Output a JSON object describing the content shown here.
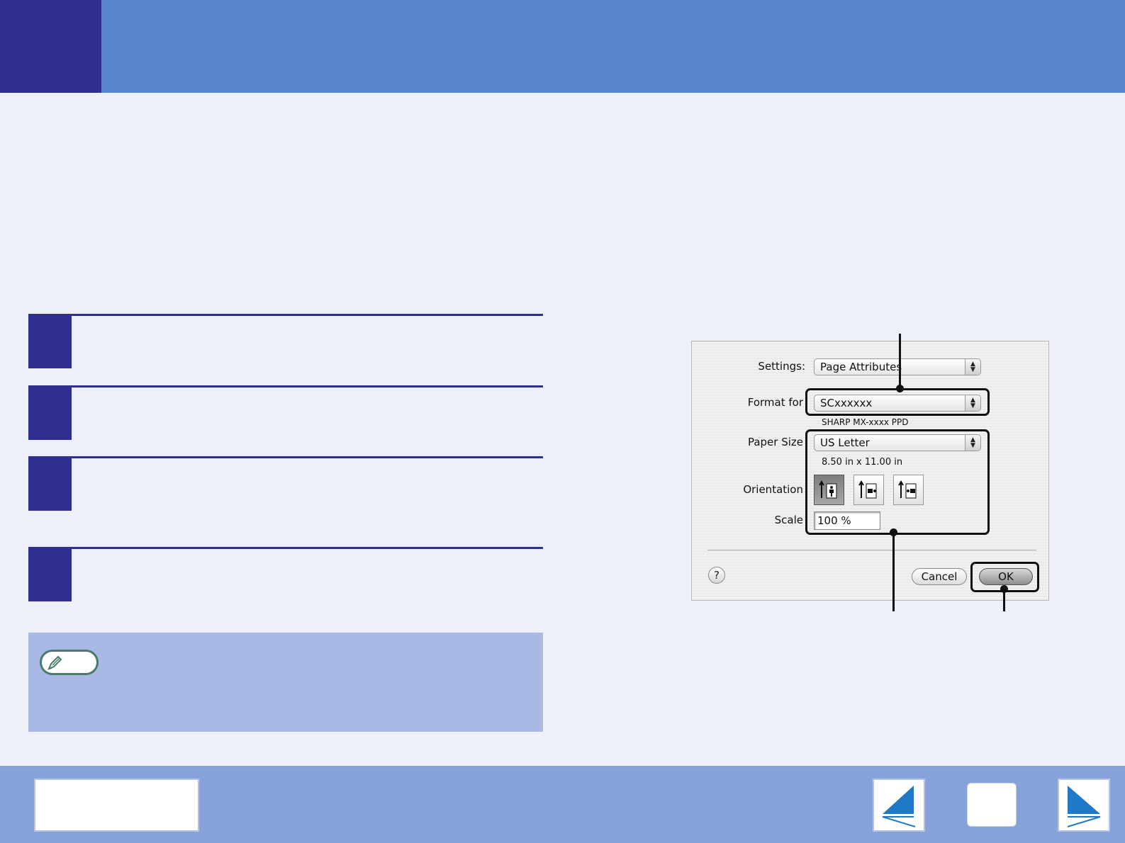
{
  "dialog": {
    "settings_label": "Settings:",
    "settings_value": "Page Attributes",
    "format_label": "Format for",
    "format_value": "SCxxxxxx",
    "format_sub": "SHARP MX-xxxx PPD",
    "paper_label": "Paper Size",
    "paper_value": "US Letter",
    "paper_sub": "8.50 in x 11.00 in",
    "orientation_label": "Orientation",
    "scale_label": "Scale",
    "scale_value": "100 %",
    "help_label": "?",
    "cancel_label": "Cancel",
    "ok_label": "OK"
  },
  "colors": {
    "header_dark": "#2e2f8f",
    "header_blue": "#5886cc",
    "footer_blue": "#87a2d8",
    "nav_arrow": "#1f78c8",
    "note_bg": "#a9b8e4"
  },
  "icons": {
    "note": "pencil-icon",
    "prev": "left-arrow-icon",
    "next": "right-arrow-icon"
  }
}
